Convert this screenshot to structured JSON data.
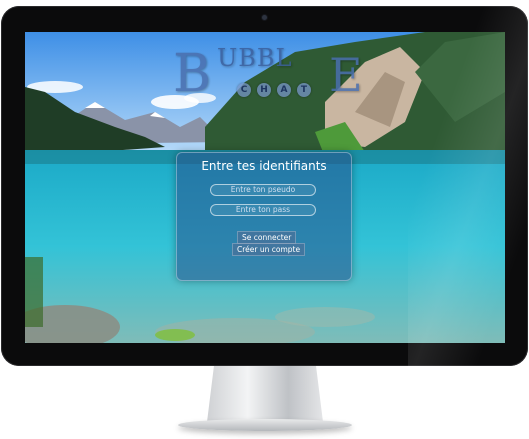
{
  "logo": {
    "big_letter": "B",
    "upper_letters": "UBBL",
    "end_letter": "E",
    "chat_letters": [
      "C",
      "H",
      "A",
      "T"
    ]
  },
  "login": {
    "title": "Entre tes identifiants",
    "pseudo_placeholder": "Entre ton pseudo",
    "pass_placeholder": "Entre ton pass",
    "login_button": "Se connecter",
    "create_button": "Créer un compte"
  }
}
